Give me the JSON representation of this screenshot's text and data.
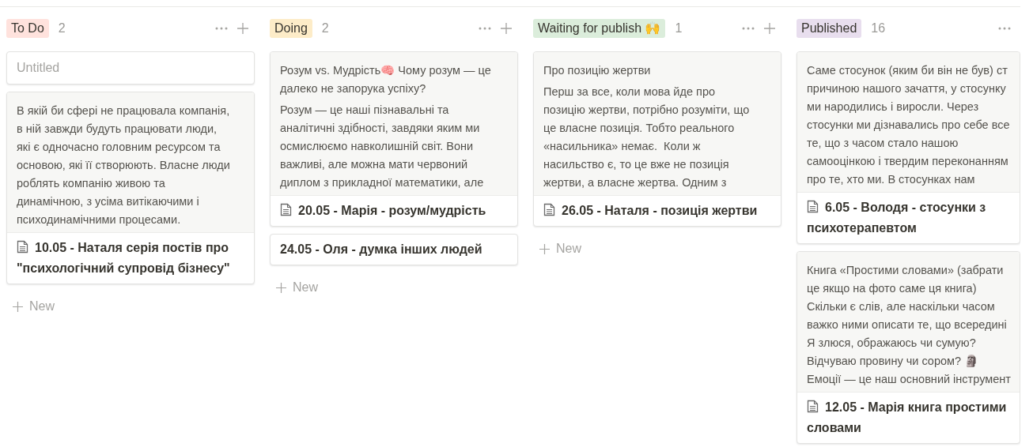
{
  "columns": [
    {
      "tag": "To Do",
      "color": "#ffe2dd",
      "count": "2",
      "new_label": "New",
      "cards": [
        {
          "untitled": true,
          "page_icon": false,
          "title": "Untitled"
        },
        {
          "untitled": false,
          "page_icon": true,
          "preview": [
            "В якій би сфері не працювала компанія,\nв ній завжди будуть працювати люди,\nякі є одночасно головним ресурсом та\nосновою, які її створюють. Власне люди\nроблять компанію живою та\nдинамічною, з усіма витікаючими і\nпсиходинамічними процесами."
          ],
          "title": "10.05 - Наталя серія постів про \"психологічний супровід бізнесу\""
        }
      ]
    },
    {
      "tag": "Doing",
      "color": "#fdecc8",
      "count": "2",
      "new_label": "New",
      "cards": [
        {
          "untitled": false,
          "page_icon": true,
          "preview": [
            "Розум vs. Мудрість🧠 Чому розум — це\nдалеко не запорука успіху?",
            "Розум — це наші пізнавальні та\nаналітичні здібності, завдяки яким ми\nосмислюємо навколишній світ. Вони\nважливі, але можна мати червоний\nдиплом з прикладної математики, але"
          ],
          "title": "20.05 - Марія - розум/мудрість"
        },
        {
          "untitled": false,
          "page_icon": false,
          "title": "24.05 - Оля - думка інших людей"
        }
      ]
    },
    {
      "tag": "Waiting for publish 🙌",
      "color": "#dbeddb",
      "count": "1",
      "new_label": "New",
      "cards": [
        {
          "untitled": false,
          "page_icon": true,
          "preview": [
            "Про позицію жертви",
            "Перш за все, коли мова йде про\nпозицію жертви, потрібно розуміти, що\nце власне позиція. Тобто реального\n«насильника» немає.  Коли ж\nнасильство є, то це вже не позиція\nжертви, а власне жертва. Одним з"
          ],
          "title": "26.05 - Наталя - позиція жертви"
        }
      ]
    },
    {
      "tag": "Published",
      "color": "#e8deee",
      "count": "16",
      "cards": [
        {
          "untitled": false,
          "page_icon": true,
          "preview": [
            "Саме стосунок (яким би він не був) ст\nпричиною нашого зачаття, у стосунку\nми народились і виросли. Через\nстосунки ми дізнавались про себе все\nте, що з часом стало нашою\nсамооцінкою і твердим переконанням\nпро те, хто ми. В стосунках нам"
          ],
          "title": "6.05 - Володя - стосунки з психотерапевтом"
        },
        {
          "untitled": false,
          "page_icon": true,
          "preview": [
            "Книга «Простими словами» (забрати\nце якщо на фото саме ця книга)\nСкільки є слів, але наскільки часом\nважко ними описати те, що всередині\nЯ злюся, ображаюсь чи сумую?\nВідчуваю провину чи сором? 🗿\nЕмоції — це наш основний інструмент"
          ],
          "title": "12.05 - Марія книга простими словами"
        }
      ]
    }
  ]
}
